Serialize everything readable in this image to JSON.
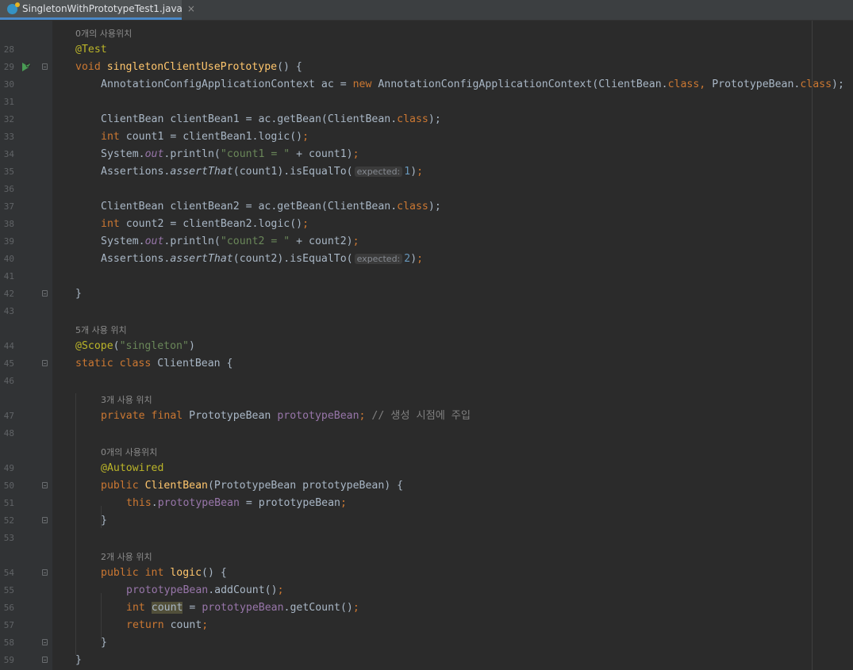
{
  "tab": {
    "title": "SingletonWithPrototypeTest1.java",
    "close": "×"
  },
  "hints": {
    "h0": "0개의 사용위치",
    "h5": "5개 사용 위치",
    "h3": "3개 사용 위치",
    "h0b": "0개의 사용위치",
    "h2": "2개 사용 위치"
  },
  "lines": [
    {
      "n": "28",
      "top": 0
    }
  ],
  "code": {
    "l28_ann": "@Test",
    "l29_kw": "void",
    "l29_fn": "singletonClientUsePrototype",
    "l29_rest": "() {",
    "l30_a": "AnnotationConfigApplicationContext ac = ",
    "l30_new": "new",
    "l30_b": " AnnotationConfigApplicationContext(ClientBean.",
    "l30_cls1": "class",
    "l30_c": ", ",
    "l30_d": "PrototypeBean.",
    "l30_cls2": "class",
    "l30_e": ");",
    "l32_a": "ClientBean clientBean1 = ac.getBean(ClientBean.",
    "l32_cls": "class",
    "l32_b": ");",
    "l33_kw": "int",
    "l33_a": " count1 = clientBean1.logic()",
    "l33_semi": ";",
    "l34_a": "System.",
    "l34_out": "out",
    "l34_b": ".println(",
    "l34_str": "\"count1 = \"",
    "l34_c": " + count1)",
    "l34_semi": ";",
    "l35_a": "Assertions.",
    "l35_m": "assertThat",
    "l35_b": "(count1).isEqualTo(",
    "l35_hint": "expected:",
    "l35_num": "1",
    "l35_c": ")",
    "l35_semi": ";",
    "l37_a": "ClientBean clientBean2 = ac.getBean(ClientBean.",
    "l37_cls": "class",
    "l37_b": ");",
    "l38_kw": "int",
    "l38_a": " count2 = clientBean2.logic()",
    "l38_semi": ";",
    "l39_a": "System.",
    "l39_out": "out",
    "l39_b": ".println(",
    "l39_str": "\"count2 = \"",
    "l39_c": " + count2)",
    "l39_semi": ";",
    "l40_a": "Assertions.",
    "l40_m": "assertThat",
    "l40_b": "(count2).isEqualTo(",
    "l40_hint": "expected:",
    "l40_num": "2",
    "l40_c": ")",
    "l40_semi": ";",
    "l42": "}",
    "l44_ann": "@Scope",
    "l44_a": "(",
    "l44_str": "\"singleton\"",
    "l44_b": ")",
    "l45_kw": "static class",
    "l45_a": " ClientBean {",
    "l47_kw": "private final",
    "l47_a": " PrototypeBean ",
    "l47_fld": "prototypeBean",
    "l47_semi": ";",
    "l47_cmt": " // 생성 시점에 주입",
    "l49_ann": "@Autowired",
    "l50_kw": "public",
    "l50_fn": " ClientBean",
    "l50_a": "(PrototypeBean prototypeBean) {",
    "l51_kw": "this",
    "l51_a": ".",
    "l51_fld": "prototypeBean",
    "l51_b": " = prototypeBean",
    "l51_semi": ";",
    "l52": "}",
    "l54_kw": "public int",
    "l54_fn": " logic",
    "l54_a": "() {",
    "l55_fld": "prototypeBean",
    "l55_a": ".addCount()",
    "l55_semi": ";",
    "l56_kw": "int",
    "l56_sp": " ",
    "l56_var": "count",
    "l56_a": " = ",
    "l56_fld": "prototypeBean",
    "l56_b": ".getCount()",
    "l56_semi": ";",
    "l57_kw": "return",
    "l57_a": " count",
    "l57_semi": ";",
    "l58": "}",
    "l59": "}"
  },
  "line_numbers": [
    "28",
    "29",
    "30",
    "31",
    "32",
    "33",
    "34",
    "35",
    "36",
    "37",
    "38",
    "39",
    "40",
    "41",
    "42",
    "43",
    "44",
    "45",
    "46",
    "47",
    "48",
    "49",
    "50",
    "51",
    "52",
    "53",
    "54",
    "55",
    "56",
    "57",
    "58",
    "59"
  ],
  "colors": {
    "background": "#2b2b2b",
    "gutter": "#313335",
    "keyword": "#cc7832",
    "annotation": "#bbb529",
    "method": "#ffc66d",
    "string": "#6a8759",
    "field": "#9876aa",
    "number": "#6897bb",
    "comment": "#808080",
    "text": "#a9b7c6"
  },
  "icons": {
    "run": "run-test-icon",
    "file": "java-class-icon"
  }
}
